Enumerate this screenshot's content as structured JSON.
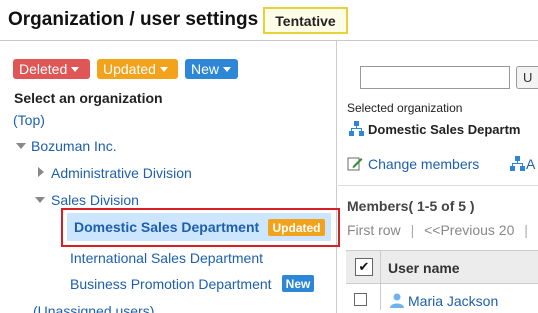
{
  "header": {
    "title": "Organization / user settings",
    "status_badge": "Tentative"
  },
  "filters": {
    "deleted": "Deleted",
    "updated": "Updated",
    "new": "New"
  },
  "tree": {
    "heading": "Select an organization",
    "top": "(Top)",
    "root": "Bozuman Inc.",
    "admin_division": "Administrative Division",
    "sales_division": "Sales Division",
    "domestic_sales": "Domestic Sales Department",
    "domestic_badge": "Updated",
    "international_sales": "International Sales Department",
    "business_promotion": "Business Promotion Department",
    "business_badge": "New",
    "unassigned": "(Unassigned users)"
  },
  "right": {
    "search_button": "U",
    "selected_org_label": "Selected organization",
    "selected_org_name": "Domestic Sales Departm",
    "change_members": "Change members",
    "a_link": "A",
    "members_heading": "Members( 1-5 of 5 )",
    "pager_first": "First row",
    "pager_sep": "|",
    "pager_previous": "<<Previous 20",
    "pager_sep2": "|",
    "th_check": "✔",
    "th_user": "User name",
    "row1_user": "Maria Jackson"
  },
  "colors": {
    "deleted": "#e05656",
    "updated": "#f3a21c",
    "new": "#2e86d6",
    "link": "#1d5fae",
    "highlight_border": "#d91f26",
    "selected_bg": "#cde6ff",
    "tentative_border": "#e7d23b"
  }
}
